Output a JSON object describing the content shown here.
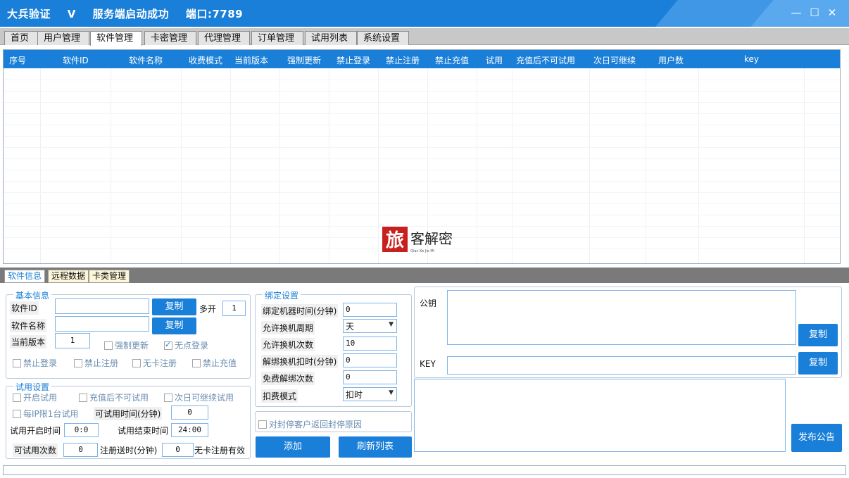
{
  "window": {
    "title_parts": [
      "大兵验证",
      "V",
      "服务端启动成功",
      "端口:7789"
    ],
    "minimize": "—",
    "maximize": "☐",
    "close": "✕"
  },
  "tabs": [
    "首页",
    "用户管理",
    "软件管理",
    "卡密管理",
    "代理管理",
    "订单管理",
    "试用列表",
    "系统设置"
  ],
  "active_tab": "软件管理",
  "grid": {
    "columns": [
      "序号",
      "软件ID",
      "软件名称",
      "收费模式",
      "当前版本",
      "强制更新",
      "禁止登录",
      "禁止注册",
      "禁止充值",
      "试用",
      "充值后不可试用",
      "次日可继续",
      "用户数",
      "key"
    ],
    "rows": []
  },
  "watermark": {
    "char": "旅",
    "text": "客解密",
    "sub": "Qian Ke Jie Mi"
  },
  "subtabs": [
    "软件信息",
    "远程数据",
    "卡类管理"
  ],
  "basic": {
    "legend": "基本信息",
    "software_id_label": "软件ID",
    "software_id_value": "",
    "copy1": "复制",
    "multi_label": "多开",
    "multi_value": "1",
    "software_name_label": "软件名称",
    "software_name_value": "",
    "copy2": "复制",
    "version_label": "当前版本",
    "version_value": "1",
    "force_update": "强制更新",
    "no_point_login": "无点登录",
    "ban_login": "禁止登录",
    "ban_register": "禁止注册",
    "no_card_register": "无卡注册",
    "ban_recharge": "禁止充值"
  },
  "trial": {
    "legend": "试用设置",
    "enable_trial": "开启试用",
    "no_trial_after_recharge": "充值后不可试用",
    "next_day_trial": "次日可继续试用",
    "ip_limit": "每IP限1台试用",
    "trial_time_label": "可试用时间(分钟)",
    "trial_time_value": "0",
    "start_label": "试用开启时间",
    "start_value": "0:0",
    "end_label": "试用结束时间",
    "end_value": "24:00",
    "count_label": "可试用次数",
    "count_value": "0",
    "reg_gift_label": "注册送时(分钟)",
    "reg_gift_value": "0",
    "no_card_valid": "无卡注册有效"
  },
  "binding": {
    "legend": "绑定设置",
    "bind_time_label": "绑定机器时间(分钟)",
    "bind_time_value": "0",
    "change_period_label": "允许换机周期",
    "change_period_value": "天",
    "change_count_label": "允许换机次数",
    "change_count_value": "10",
    "unbind_deduct_label": "解绑换机扣时(分钟)",
    "unbind_deduct_value": "0",
    "free_unbind_label": "免费解绑次数",
    "free_unbind_value": "0",
    "deduct_mode_label": "扣费模式",
    "deduct_mode_value": "扣时",
    "return_reason": "对封停客户返回封停原因",
    "add_button": "添加",
    "refresh_button": "刷新列表"
  },
  "keys": {
    "public_key_label": "公钥",
    "public_key_value": "",
    "copy_public": "复制",
    "key_label": "KEY",
    "key_value": "",
    "copy_key": "复制",
    "announcement": "",
    "publish_button": "发布公告"
  }
}
